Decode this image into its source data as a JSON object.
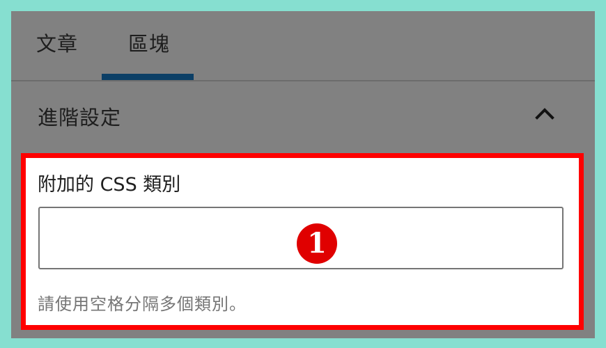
{
  "tabs": [
    {
      "label": "文章"
    },
    {
      "label": "區塊"
    }
  ],
  "active_tab": "區塊",
  "section": {
    "title": "進階設定",
    "expanded": true
  },
  "field": {
    "label": "附加的 CSS 類別",
    "value": "",
    "help": "請使用空格分隔多個類別。"
  },
  "annotation": {
    "marker": "1",
    "outline_color": "#ff0000",
    "marker_color": "#e00000"
  },
  "colors": {
    "page_bg": "#86dfd0",
    "panel_overlay": "#818181",
    "tab_indicator": "#0c3f66"
  }
}
